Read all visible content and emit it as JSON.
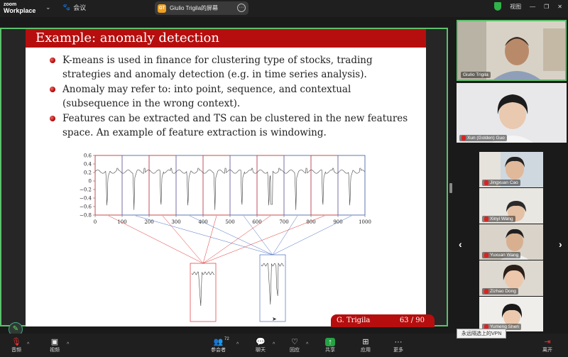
{
  "app": {
    "logo_line1": "zoom",
    "logo_line2": "Workplace"
  },
  "topbar": {
    "meeting_label": "会议",
    "share_title": "Giulio Trigila的屏幕",
    "view_label": "视图"
  },
  "slide": {
    "title": "Example: anomaly detection",
    "bullets": [
      "K-means is used in finance for clustering type of stocks, trading strategies and anomaly detection (e.g. in time series analysis).",
      "Anomaly may refer to: into point, sequence, and contextual (subsequence in the wrong context).",
      "Features can be extracted and TS can be clustered in the new features space. An example of feature extraction is windowing."
    ],
    "footer_author": "G. Trigila",
    "footer_page": "63 / 90"
  },
  "chart_data": {
    "type": "line",
    "x_ticks": [
      "0",
      "100",
      "200",
      "300",
      "400",
      "500",
      "600",
      "700",
      "800",
      "900",
      "1000"
    ],
    "y_ticks": [
      "0.6",
      "0.4",
      "0.2",
      "0",
      "−0.2",
      "−0.4",
      "−0.6",
      "−0.8"
    ],
    "xlim": [
      0,
      1000
    ],
    "ylim": [
      -0.8,
      0.6
    ],
    "window_starts": [
      0,
      100,
      200,
      300,
      400,
      500,
      600,
      700,
      800,
      900
    ],
    "window_colors": [
      "#d33",
      "#4a6fc0",
      "#d33",
      "#4a6fc0",
      "#d33",
      "#4a6fc0",
      "#d33",
      "#4a6fc0",
      "#d33",
      "#4a6fc0"
    ],
    "colors": {
      "red": "#d33",
      "blue": "#4a6fc0",
      "signal": "#444"
    }
  },
  "participants": [
    {
      "name": "Giulio Trigila",
      "muted": false
    },
    {
      "name": "Xun (Golden) Guo",
      "muted": true
    },
    {
      "name": "Jingxuan Cao",
      "muted": true
    },
    {
      "name": "Xinyi Wang",
      "muted": true
    },
    {
      "name": "Yuxuan Wang",
      "muted": true
    },
    {
      "name": "Zizhao Dong",
      "muted": true
    },
    {
      "name": "Yumeng Shen",
      "muted": true
    }
  ],
  "bottombar": {
    "audio": "音频",
    "video": "视频",
    "participants": "参会者",
    "participants_count": "72",
    "chat": "聊天",
    "react": "回应",
    "share": "共享",
    "apps": "应用",
    "more": "更多",
    "leave": "离开"
  },
  "tooltip": "永远隔选上的VPN"
}
